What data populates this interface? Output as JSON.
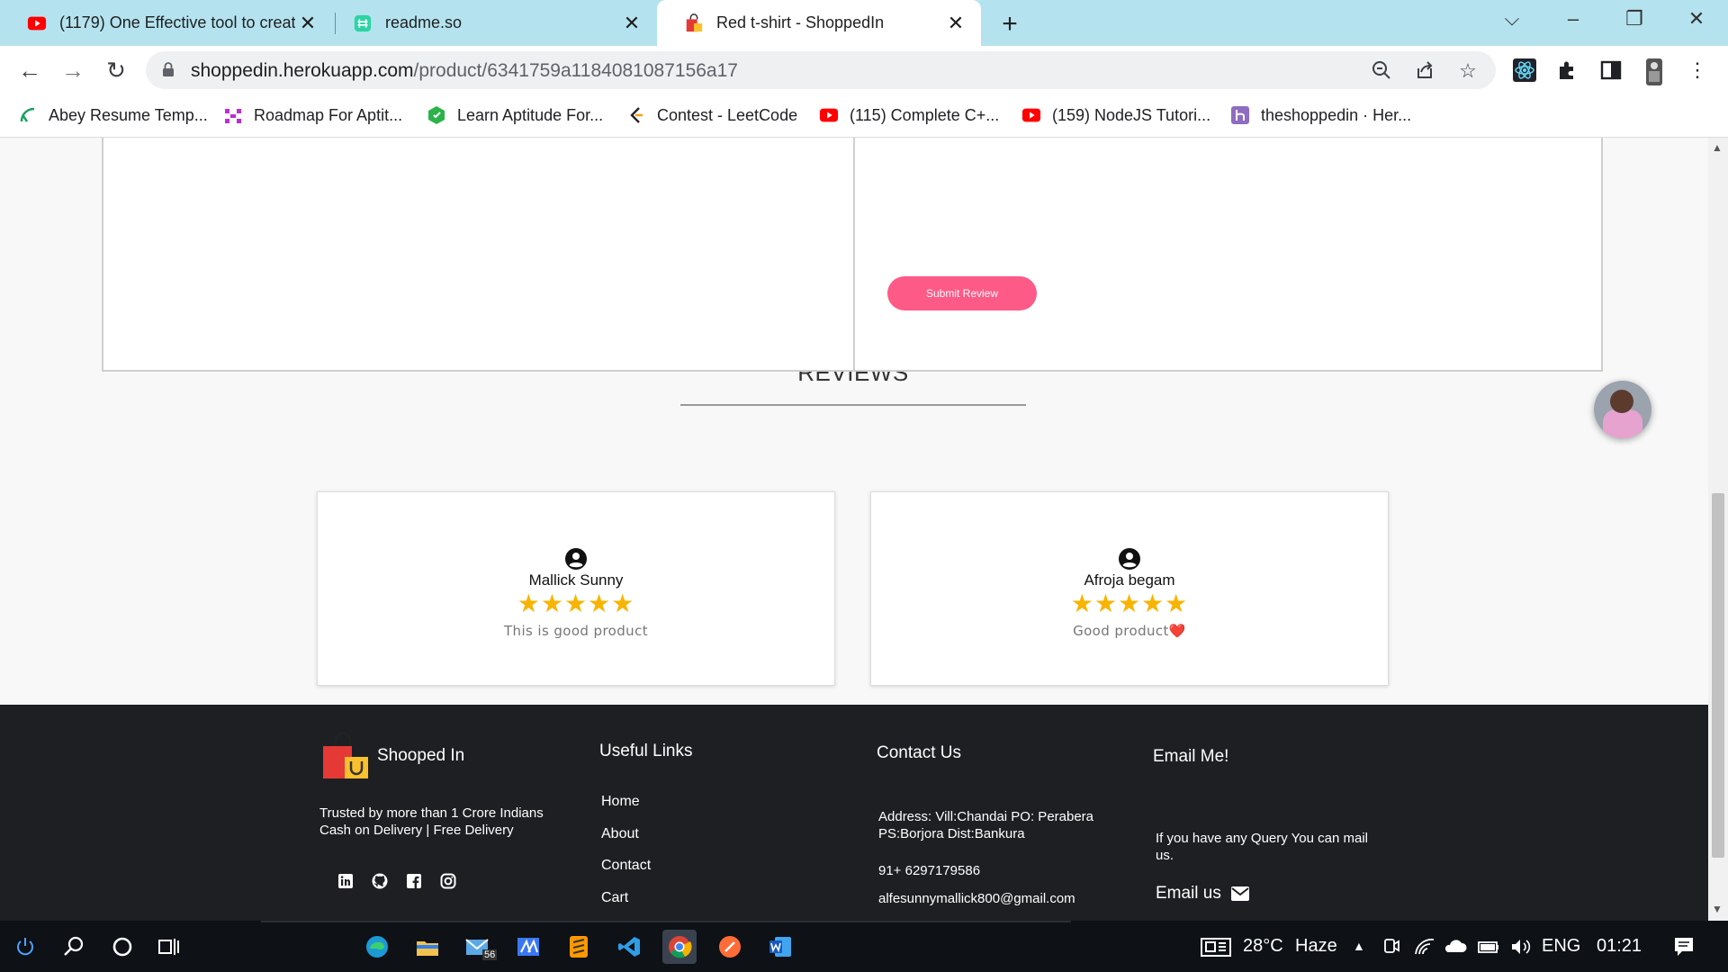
{
  "tabs": [
    {
      "title": "(1179) One Effective tool to creat",
      "favicon": "youtube-icon",
      "active": false
    },
    {
      "title": "readme.so",
      "favicon": "readme-icon",
      "active": false
    },
    {
      "title": "Red t-shirt - ShoppedIn",
      "favicon": "shopping-bag-icon",
      "active": true
    }
  ],
  "toolbar": {
    "url_host": "shoppedin.herokuapp.com",
    "url_path": "/product/6341759a1184081087156a17"
  },
  "bookmarks": [
    {
      "label": "Abey Resume Temp...",
      "icon": "resume-icon",
      "color": "#1aa260"
    },
    {
      "label": "Roadmap For Aptit...",
      "icon": "roadmap-icon",
      "color": "#c02bd6"
    },
    {
      "label": "Learn Aptitude For...",
      "icon": "aptitude-icon",
      "color": "#2bb34a"
    },
    {
      "label": "Contest - LeetCode",
      "icon": "leetcode-icon",
      "color": "#f89f1b"
    },
    {
      "label": "(115) Complete C+...",
      "icon": "youtube-icon",
      "color": "#ff0000"
    },
    {
      "label": "(159) NodeJS Tutori...",
      "icon": "youtube-icon",
      "color": "#ff0000"
    },
    {
      "label": "theshoppedin · Her...",
      "icon": "heroku-icon",
      "color": "#8e6cc0"
    }
  ],
  "review_form": {
    "submit_label": "Submit Review"
  },
  "reviews": {
    "heading": "REVIEWS",
    "items": [
      {
        "name": "Mallick Sunny",
        "rating": 5,
        "stars": "★★★★★",
        "text": "This is good product"
      },
      {
        "name": "Afroja begam",
        "rating": 5,
        "stars": "★★★★★",
        "text": "Good product❤️"
      }
    ]
  },
  "footer": {
    "brand": "Shooped In",
    "tagline_1": "Trusted by more than 1 Crore Indians",
    "tagline_2": "Cash on Delivery | Free Delivery",
    "links_heading": "Useful Links",
    "links": [
      "Home",
      "About",
      "Contact",
      "Cart"
    ],
    "contact_heading": "Contact Us",
    "address_1": "Address: Vill:Chandai PO: Perabera",
    "address_2": "PS:Borjora Dist:Bankura",
    "phone": "91+ 6297179586",
    "email": "alfesunnymallick800@gmail.com",
    "email_heading": "Email Me!",
    "email_text_1": "If you have any Query You can mail",
    "email_text_2": "us.",
    "email_button": "Email us"
  },
  "taskbar": {
    "mail_badge": "56",
    "temperature": "28°C",
    "weather": "Haze",
    "language": "ENG",
    "time": "01:21"
  },
  "colors": {
    "tab_bar": "#b4e3ef",
    "submit_button": "#fe5a87",
    "star": "#f8b400",
    "footer_bg": "#1e1f22"
  }
}
